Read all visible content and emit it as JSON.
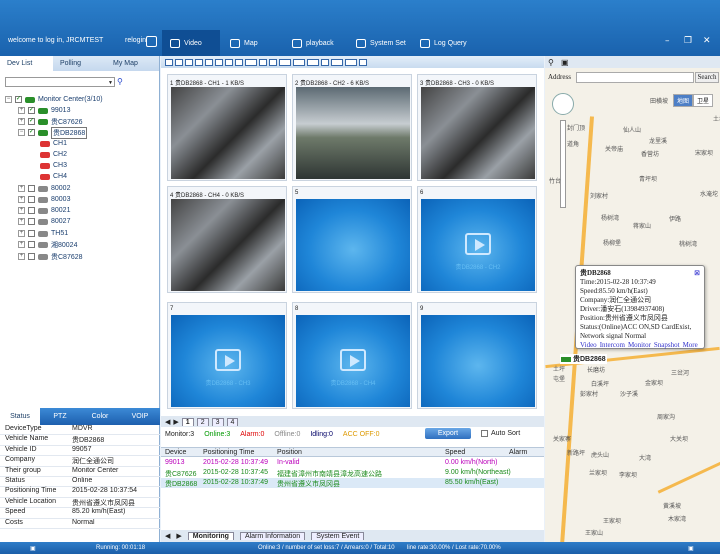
{
  "header": {
    "welcome": "welcome to log in, JRCMTEST",
    "relogin": "relogin",
    "tabs": [
      {
        "label": "Video"
      },
      {
        "label": "Map"
      },
      {
        "label": "playback"
      },
      {
        "label": "System Set"
      },
      {
        "label": "Log Query"
      }
    ]
  },
  "left_tabs": [
    "Dev List",
    "Polling",
    "My Map"
  ],
  "tree": {
    "root": "Monitor Center(3/10)",
    "items": [
      {
        "label": "99013"
      },
      {
        "label": "贵C87626"
      },
      {
        "label": "贵DB2868"
      },
      {
        "label": "CH1"
      },
      {
        "label": "CH2"
      },
      {
        "label": "CH3"
      },
      {
        "label": "CH4"
      },
      {
        "label": "80002"
      },
      {
        "label": "80003"
      },
      {
        "label": "80021"
      },
      {
        "label": "80027"
      },
      {
        "label": "TH51"
      },
      {
        "label": "湘80024"
      },
      {
        "label": "贵C87628"
      }
    ]
  },
  "status_tabs": [
    "Status",
    "PTZ",
    "Color",
    "VOIP"
  ],
  "status": [
    [
      "DeviceType",
      "MDVR"
    ],
    [
      "Vehicle Name",
      "贵DB2868"
    ],
    [
      "Vehicle ID",
      "99057"
    ],
    [
      "Company",
      "润仁全通公司"
    ],
    [
      "Their group",
      "Monitor Center"
    ],
    [
      "Status",
      "Online"
    ],
    [
      "Positioning Time",
      "2015-02-28 10:37:54"
    ],
    [
      "Vehicle Location",
      "贵州省遵义市凤冈县"
    ],
    [
      "Speed",
      "85.20 km/h(East)"
    ],
    [
      "Costs",
      "Normal"
    ]
  ],
  "video_cells": [
    {
      "title": "1      贵DB2868 - CH1 - 1 KB/S",
      "caption": ""
    },
    {
      "title": "2      贵DB2868 - CH2 - 6 KB/S",
      "caption": ""
    },
    {
      "title": "3      贵DB2868 - CH3 - 0 KB/S",
      "caption": ""
    },
    {
      "title": "4      贵DB2868 - CH4 - 0 KB/S",
      "caption": ""
    },
    {
      "title": "5",
      "caption": ""
    },
    {
      "title": "6",
      "caption": "贵DB2868 - CH2"
    },
    {
      "title": "7",
      "caption": "贵DB2868 - CH3"
    },
    {
      "title": "8",
      "caption": "贵DB2868 - CH4"
    },
    {
      "title": "9",
      "caption": ""
    }
  ],
  "pages": [
    "1",
    "2",
    "3",
    "4"
  ],
  "stats": {
    "monitor": "Monitor:3",
    "online": "Online:3",
    "alarm": "Alarm:0",
    "offline": "Offline:0",
    "idling": "Idling:0",
    "acc": "ACC OFF:0",
    "export": "Export",
    "auto_sort": "Auto Sort"
  },
  "table": {
    "headers": [
      "Device",
      "Positioning Time",
      "Position",
      "Speed",
      "Alarm"
    ],
    "rows": [
      [
        "99013",
        "2015-02-28 10:37:49",
        "In-valid",
        "0.00 km/h(North)",
        ""
      ],
      [
        "贵C87626",
        "2015-02-28 10:37:45",
        "福建省漳州市南靖县漳龙高速公路",
        "9.00 km/h(Northeast)",
        ""
      ],
      [
        "贵DB2868",
        "2015-02-28 10:37:49",
        "贵州省遵义市凤冈县",
        "85.50 km/h(East)",
        ""
      ]
    ]
  },
  "bottom_tabs": [
    "Monitoring",
    "Alarm Information",
    "System Event"
  ],
  "map": {
    "address_label": "Address",
    "search": "Search",
    "types": [
      "地图",
      "卫星"
    ],
    "popup": {
      "title": "贵DB2868",
      "time": "Time:2015-02-28 10:37:49",
      "speed": "Speed:85.50 km/h(East)",
      "company": "Company:润仁全通公司",
      "driver": "Driver:潘安石(13984937408)",
      "position": "Position:贵州省遵义市凤冈县",
      "status": "Status:(Online)ACC ON,SD CardExist, Network signal Normal",
      "links": [
        "Video",
        "Intercom",
        "Monitor",
        "Snapshot",
        "More"
      ]
    },
    "vehicle": "贵DB2868",
    "labels": [
      "田横坡",
      "土坪",
      "封门顶",
      "仙人山",
      "龙里溪",
      "香营坊",
      "关帝庙",
      "宋家坝",
      "道角",
      "竹台",
      "刘家村",
      "青坪坝",
      "杨树湾",
      "蒋家山",
      "水淹坨",
      "伊路",
      "杨柳堡",
      "桃树湾",
      "土坪",
      "长磨坊",
      "三岔河",
      "屯堡",
      "白溪坪",
      "金家坝",
      "沙子溪",
      "彭家村",
      "周家沟",
      "大关坝",
      "虎头山",
      "关家寨",
      "新路坪",
      "兰家坝",
      "大湾",
      "李家坝",
      "黄溪坡",
      "王家山",
      "王家坝",
      "木家湾"
    ]
  },
  "footer": {
    "running": "Running: 00:01:18",
    "online": "Online:3 / number of set loss:7 / Arrears:0 / Total:10",
    "rate": "line rate:30.00% / Lost rate:70.00%"
  }
}
